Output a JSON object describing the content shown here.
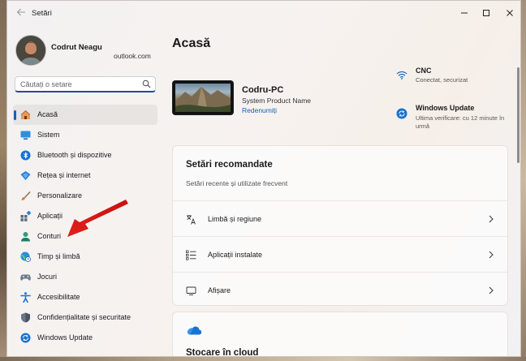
{
  "window": {
    "title": "Setări"
  },
  "profile": {
    "name": "Codrut Neagu",
    "email": "outlook.com"
  },
  "search": {
    "placeholder": "Căutați o setare"
  },
  "nav": {
    "items": [
      {
        "label": "Acasă",
        "icon": "home-icon",
        "active": true
      },
      {
        "label": "Sistem",
        "icon": "system-icon"
      },
      {
        "label": "Bluetooth și dispozitive",
        "icon": "bluetooth-icon"
      },
      {
        "label": "Rețea și internet",
        "icon": "network-icon"
      },
      {
        "label": "Personalizare",
        "icon": "brush-icon"
      },
      {
        "label": "Aplicații",
        "icon": "apps-icon"
      },
      {
        "label": "Conturi",
        "icon": "account-icon"
      },
      {
        "label": "Timp și limbă",
        "icon": "globe-clock-icon"
      },
      {
        "label": "Jocuri",
        "icon": "gamepad-icon"
      },
      {
        "label": "Accesibilitate",
        "icon": "accessibility-icon"
      },
      {
        "label": "Confidențialitate și securitate",
        "icon": "shield-icon"
      },
      {
        "label": "Windows Update",
        "icon": "update-icon"
      }
    ]
  },
  "main": {
    "title": "Acasă",
    "pc": {
      "name": "Codru-PC",
      "model": "System Product Name",
      "rename": "Redenumiți"
    },
    "status": {
      "network": {
        "title": "CNC",
        "subtitle": "Conectat, securizat"
      },
      "update": {
        "title": "Windows Update",
        "subtitle": "Ultima verificare: cu 12 minute în urmă"
      }
    },
    "recommended": {
      "title": "Setări recomandate",
      "subtitle": "Setări recente și utilizate frecvent",
      "rows": [
        {
          "label": "Limbă și regiune",
          "icon": "language-icon"
        },
        {
          "label": "Aplicații instalate",
          "icon": "list-icon"
        },
        {
          "label": "Afișare",
          "icon": "monitor-icon"
        }
      ]
    },
    "cloud": {
      "title": "Stocare în cloud"
    }
  },
  "colors": {
    "accent": "#1a5fb4",
    "arrow": "#e0201b"
  }
}
